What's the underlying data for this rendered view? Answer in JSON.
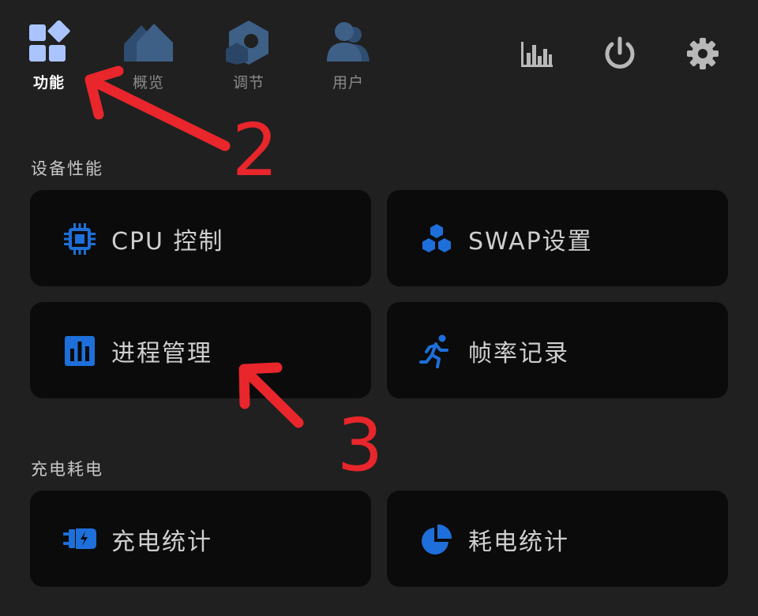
{
  "colors": {
    "background": "#202020",
    "card": "#0b0b0b",
    "accent": "#1e6fd9",
    "annotation": "#e8262b"
  },
  "topnav": {
    "tabs": [
      {
        "label": "功能",
        "icon": "apps-icon",
        "active": true
      },
      {
        "label": "概览",
        "icon": "home-icon",
        "active": false
      },
      {
        "label": "调节",
        "icon": "tune-icon",
        "active": false
      },
      {
        "label": "用户",
        "icon": "user-icon",
        "active": false
      }
    ],
    "tools": [
      {
        "icon": "bar-chart-icon"
      },
      {
        "icon": "power-icon"
      },
      {
        "icon": "gear-icon"
      }
    ]
  },
  "sections": [
    {
      "title": "设备性能",
      "cards": [
        {
          "label": "CPU 控制",
          "icon": "cpu-icon"
        },
        {
          "label": "SWAP设置",
          "icon": "swap-icon"
        },
        {
          "label": "进程管理",
          "icon": "process-icon"
        },
        {
          "label": "帧率记录",
          "icon": "running-icon"
        }
      ]
    },
    {
      "title": "充电耗电",
      "cards": [
        {
          "label": "充电统计",
          "icon": "charging-icon"
        },
        {
          "label": "耗电统计",
          "icon": "pie-chart-icon"
        }
      ]
    }
  ],
  "annotations": [
    {
      "label": "2"
    },
    {
      "label": "3"
    }
  ]
}
